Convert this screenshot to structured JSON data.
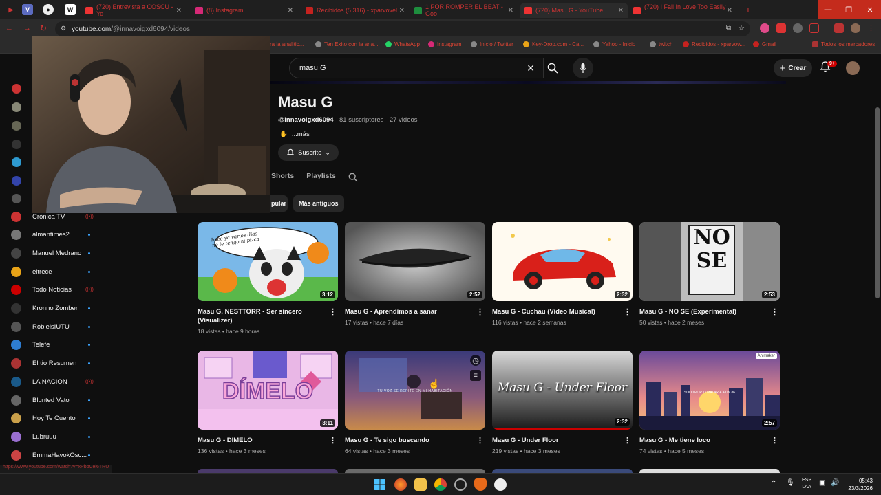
{
  "browser": {
    "tabs": [
      {
        "label": "(720) Entrevista a COSCU - Yo",
        "color": "#e33"
      },
      {
        "label": "(8) Instagram",
        "color": "#d62976"
      },
      {
        "label": "Recibidos (5.316) - xparvovel",
        "color": "#c5221f"
      },
      {
        "label": "1 POR ROMPER EL BEAT - Goo",
        "color": "#1e8e3e"
      },
      {
        "label": "(720) Masu G - YouTube",
        "color": "#e33"
      },
      {
        "label": "(720) I Fall In Love Too Easily -",
        "color": "#e33"
      }
    ],
    "url_host": "youtube.com",
    "url_path": "/@innavoigxd6094/videos",
    "bookmarks": [
      "ra la analitic...",
      "Ten Exito con la ana...",
      "WhatsApp",
      "Instagram",
      "Inicio / Twitter",
      "Key-Drop.com - Ca...",
      "Yahoo - Inicio",
      "twitch",
      "Recibidos - xparvow...",
      "Gmail",
      "Todos los marcadores"
    ]
  },
  "youtube": {
    "search_query": "masu G",
    "create_label": "Crear",
    "notif_count": "9+"
  },
  "channel": {
    "name": "Masu G",
    "handle": "@innavoigxd6094",
    "meta": " · 81 suscriptores · 27 videos",
    "more": "...más",
    "subscribed_label": "Suscrito",
    "tabs": [
      "Shorts",
      "Playlists"
    ],
    "filters": [
      "pular",
      "Más antiguos"
    ]
  },
  "subscriptions": [
    {
      "name": "Crónica TV",
      "color": "#c33",
      "live": true
    },
    {
      "name": "almantimes2",
      "color": "#777",
      "live": false
    },
    {
      "name": "Manuel Medrano",
      "color": "#444",
      "live": false
    },
    {
      "name": "eltrece",
      "color": "#e8a317",
      "live": false
    },
    {
      "name": "Todo Noticias",
      "color": "#c00",
      "live": true
    },
    {
      "name": "Kronno Zomber",
      "color": "#333",
      "live": false
    },
    {
      "name": "RobleisIUTU",
      "color": "#555",
      "live": false
    },
    {
      "name": "Telefe",
      "color": "#2e7dd1",
      "live": false
    },
    {
      "name": "El tio Resumen",
      "color": "#a33",
      "live": false
    },
    {
      "name": "LA NACION",
      "color": "#1a5a8a",
      "live": true
    },
    {
      "name": "Blunted Vato",
      "color": "#666",
      "live": false
    },
    {
      "name": "Hoy Te Cuento",
      "color": "#caa04a",
      "live": false
    },
    {
      "name": "Lubruuu",
      "color": "#9a6fd0",
      "live": false
    },
    {
      "name": "EmmaHavokOsc...",
      "color": "#c44",
      "live": false
    }
  ],
  "videos": [
    {
      "title": "Masu G, NESTTORR - Ser sincero (Visualizer)",
      "meta": "18 vistas • hace 9 horas",
      "duration": "3:12"
    },
    {
      "title": "Masu G - Aprendimos a sanar",
      "meta": "17 vistas • hace 7 días",
      "duration": "2:52"
    },
    {
      "title": "Masu G - Cuchau (Video Musical)",
      "meta": "116 vistas • hace 2 semanas",
      "duration": "2:32"
    },
    {
      "title": "Masu G - NO SE (Experimental)",
      "meta": "50 vistas • hace 2 meses",
      "duration": "2:53"
    },
    {
      "title": "Masu G - DIMELO",
      "meta": "136 vistas • hace 3 meses",
      "duration": "3:11"
    },
    {
      "title": "Masu G - Te sigo buscando",
      "meta": "64 vistas • hace 3 meses",
      "duration": ""
    },
    {
      "title": "Masu G - Under Floor",
      "meta": "219 vistas • hace 3 meses",
      "duration": "2:32"
    },
    {
      "title": "Masu G - Me tiene loco",
      "meta": "74 vistas • hace 5 meses",
      "duration": "2:57"
    }
  ],
  "thumb_text": {
    "cat_bubble": "hace ya varios días\nno le tengo ni pizca",
    "no_se_top": "NO",
    "no_se_bottom": "SE",
    "dimelo": "DÍMELO",
    "te_sigo_caption": "TU VOZ SE REPITE EN MI HABITACIÓN",
    "under_floor": "Masu G - Under Floor",
    "me_tiene_badge": "Animaker",
    "me_tiene_caption": "SOLO POR TI MATARÍA A UN 86"
  },
  "status_url": "https://www.youtube.com/watch?v=xPbbCel6TRU",
  "taskbar": {
    "lang_top": "ESP",
    "lang_bottom": "LAA",
    "time": "05:43",
    "date": "23/3/2026"
  }
}
